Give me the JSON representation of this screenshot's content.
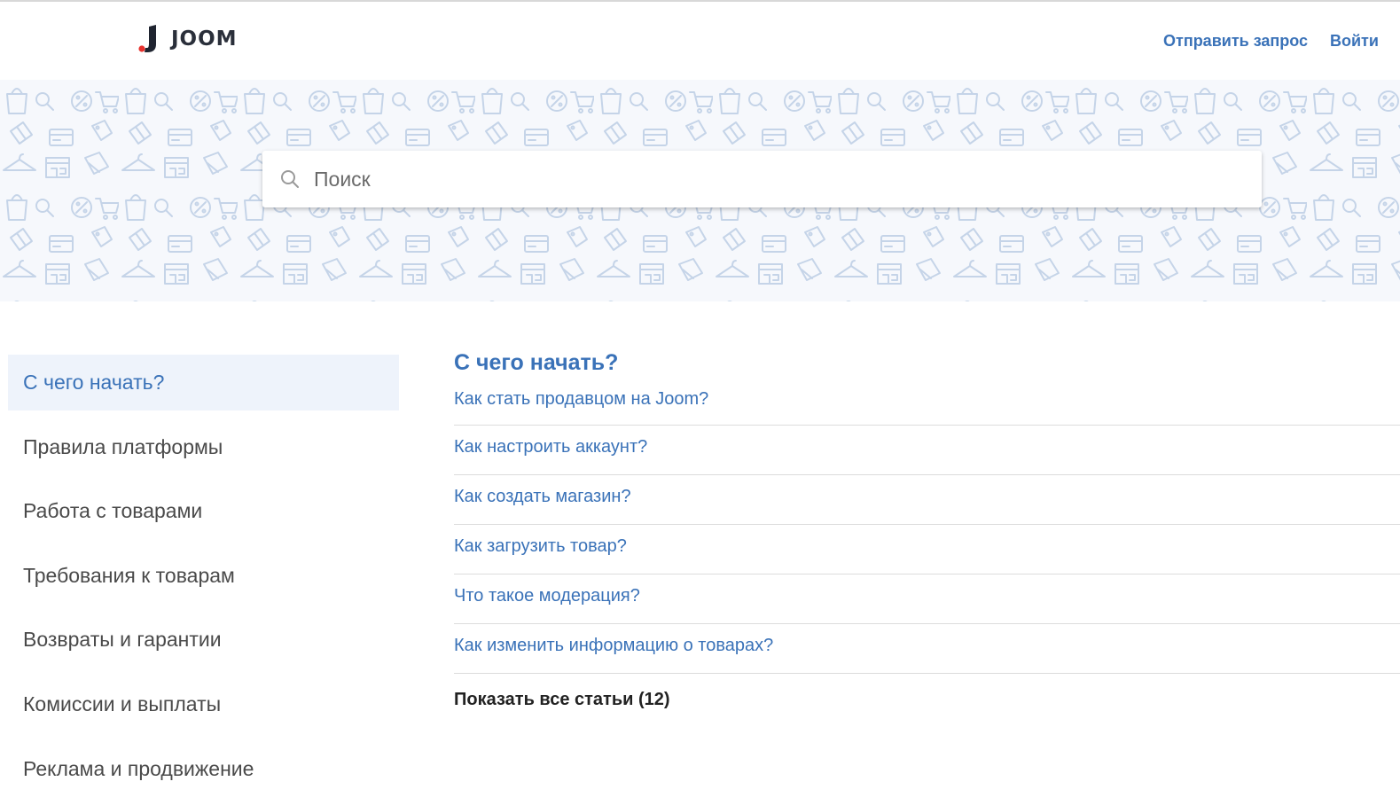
{
  "header": {
    "logo_text": "JOOM",
    "brand_colors": {
      "mark_dark": "#1f2430",
      "mark_red": "#e8322e",
      "link": "#3a72b8"
    },
    "send_request": "Отправить запрос",
    "login": "Войти"
  },
  "search": {
    "placeholder": "Поиск",
    "value": ""
  },
  "sidebar": {
    "items": [
      {
        "label": "С чего начать?",
        "active": true
      },
      {
        "label": "Правила платформы"
      },
      {
        "label": "Работа с товарами"
      },
      {
        "label": "Требования к товарам"
      },
      {
        "label": "Возвраты и гарантии"
      },
      {
        "label": "Комиссии и выплаты"
      },
      {
        "label": "Реклама и продвижение"
      }
    ]
  },
  "main": {
    "section_title": "С чего начать?",
    "articles": [
      "Как стать продавцом на Joom?",
      "Как настроить аккаунт?",
      "Как создать магазин?",
      "Как загрузить товар?",
      "Что такое модерация?",
      "Как изменить информацию о товарах?"
    ],
    "show_all": "Показать все статьи (12)"
  }
}
